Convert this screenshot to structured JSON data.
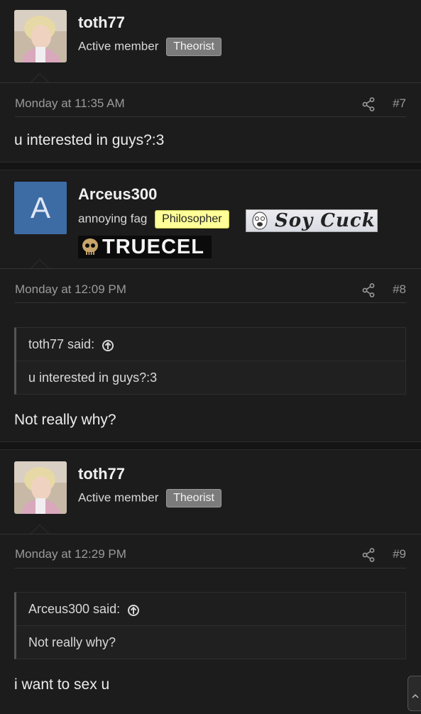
{
  "posts": [
    {
      "username": "toth77",
      "user_title": "Active member",
      "badge": "Theorist",
      "date": "Monday at 11:35 AM",
      "post_number": "#7",
      "message": "u interested in guys?:3"
    },
    {
      "username": "Arceus300",
      "avatar_letter": "A",
      "user_title": "annoying fag",
      "badge": "Philosopher",
      "banner_soy": "Soy Cuck",
      "banner_truecel": "TRUECEL",
      "date": "Monday at 12:09 PM",
      "post_number": "#8",
      "quote_author": "toth77 said:",
      "quote_text": "u interested in guys?:3",
      "message": "Not really why?"
    },
    {
      "username": "toth77",
      "user_title": "Active member",
      "badge": "Theorist",
      "date": "Monday at 12:29 PM",
      "post_number": "#9",
      "quote_author": "Arceus300 said:",
      "quote_text": "Not really why?",
      "message": "i want to sex u"
    }
  ],
  "colors": {
    "background": "#1c1c1d",
    "avatar_blue": "#3d6ca5",
    "badge_gray": "#7b7b7b",
    "badge_yellow": "#ffff99"
  }
}
